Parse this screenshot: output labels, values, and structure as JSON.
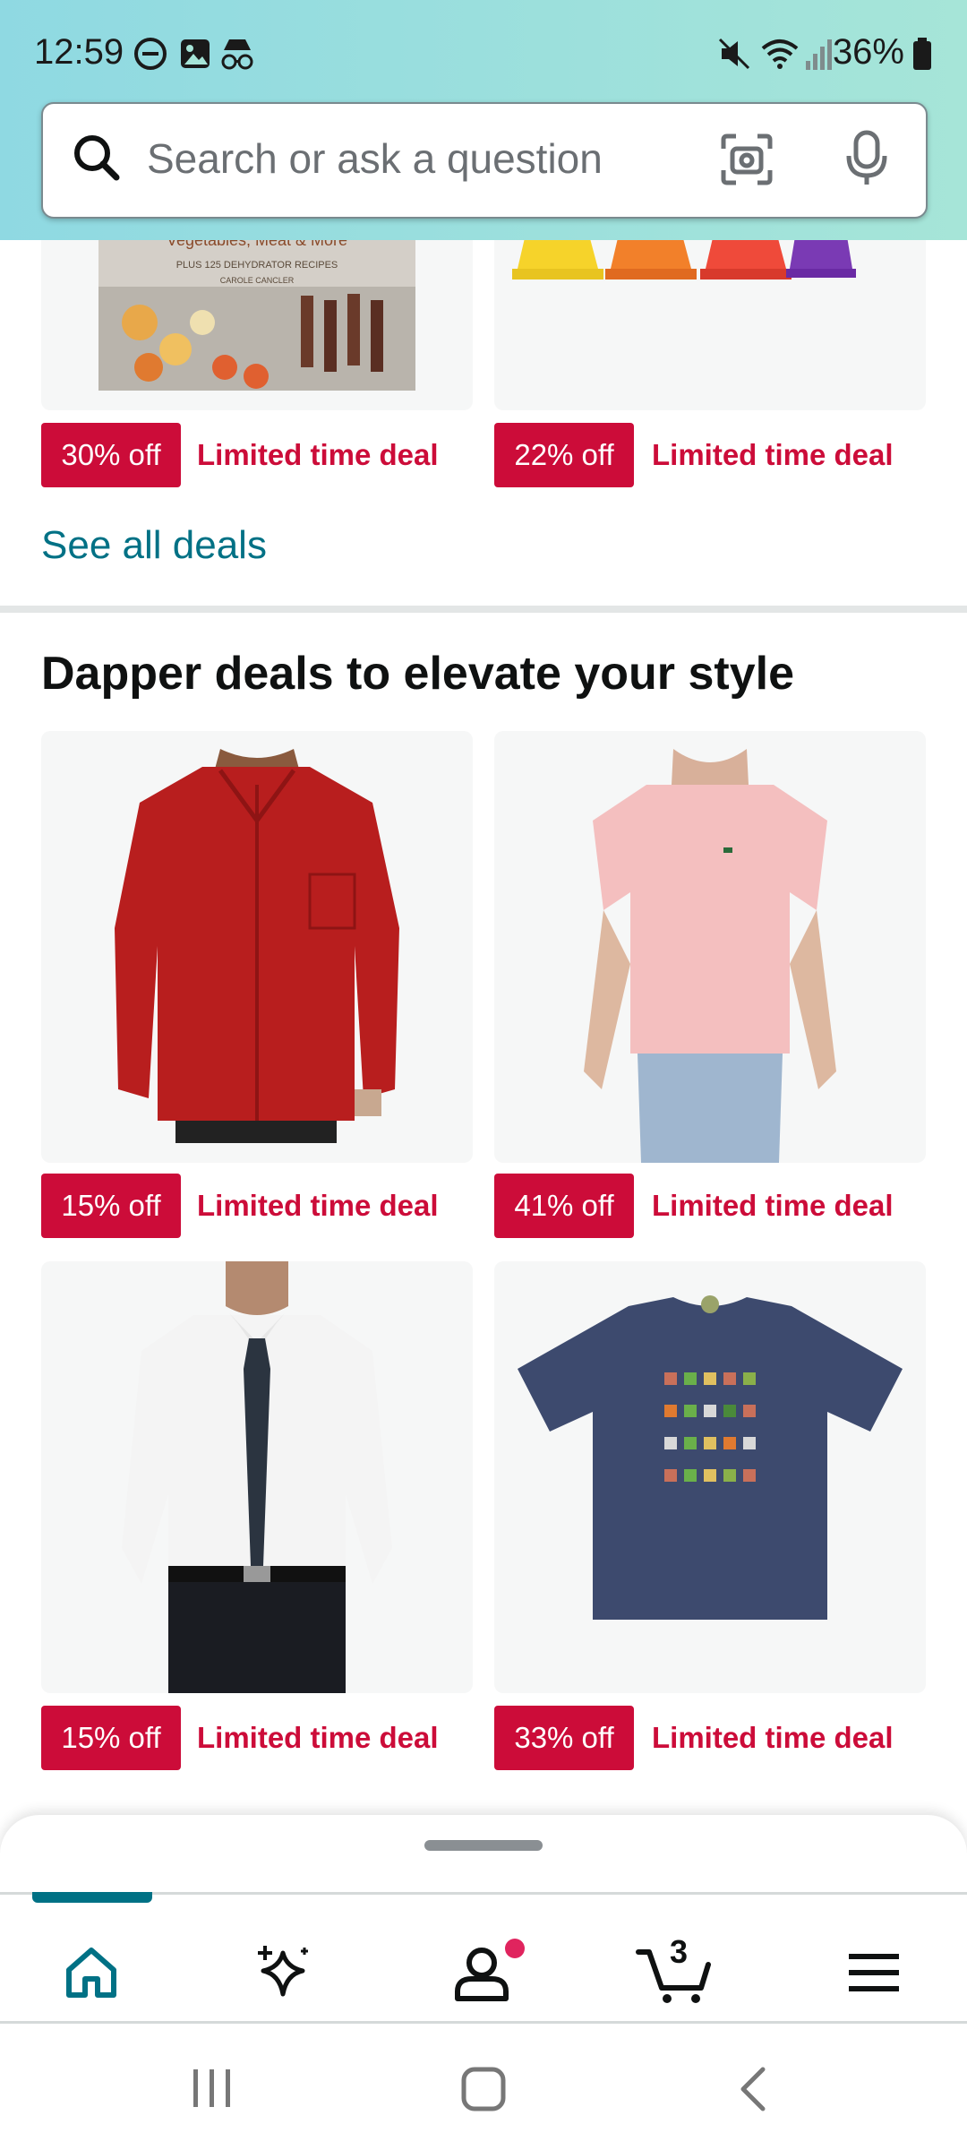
{
  "status_bar": {
    "time": "12:59",
    "battery": "36%"
  },
  "search": {
    "placeholder": "Search or ask a question"
  },
  "top_deals": [
    {
      "discount": "30% off",
      "label": "Limited time deal",
      "image_caption": "Vegetables, Meat & More",
      "image_subcaption": "PLUS 125 DEHYDRATOR RECIPES",
      "image_author": "CAROLE CANCLER"
    },
    {
      "discount": "22% off",
      "label": "Limited time deal"
    }
  ],
  "see_all_label": "See all deals",
  "section": {
    "title": "Dapper deals to elevate your style",
    "items": [
      {
        "discount": "15% off",
        "label": "Limited time deal",
        "product": "red-shirt"
      },
      {
        "discount": "41% off",
        "label": "Limited time deal",
        "product": "pink-tshirt"
      },
      {
        "discount": "15% off",
        "label": "Limited time deal",
        "product": "white-dress-shirt"
      },
      {
        "discount": "33% off",
        "label": "Limited time deal",
        "product": "navy-graphic-tshirt"
      }
    ]
  },
  "nav": {
    "cart_count": "3"
  },
  "colors": {
    "accent": "#007185",
    "deal_red": "#cc0c39",
    "header_start": "#8fd9e2",
    "header_end": "#a6e5d8"
  }
}
